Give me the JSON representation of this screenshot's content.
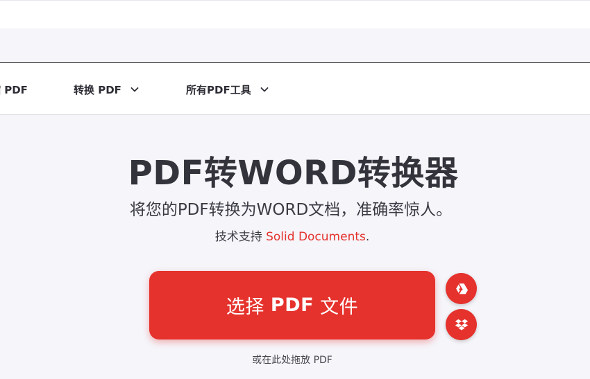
{
  "nav": {
    "compress": "缩 PDF",
    "convert": "转换 PDF",
    "all_tools": "所有PDF工具"
  },
  "hero": {
    "title": "PDF转WORD转换器",
    "subtitle": "将您的PDF转换为WORD文档，准确率惊人。",
    "powered_prefix": "技术支持",
    "powered_link": "Solid Documents",
    "powered_suffix": ".",
    "select_prefix": "选择",
    "select_bold": "PDF",
    "select_suffix": "文件",
    "drop_hint": "或在此处拖放 PDF"
  },
  "icons": {
    "gdrive": "google-drive-icon",
    "dropbox": "dropbox-icon",
    "chevron": "chevron-down-icon"
  },
  "colors": {
    "brand_red": "#e5322d",
    "background": "#f5f5fa",
    "text": "#33333b"
  }
}
